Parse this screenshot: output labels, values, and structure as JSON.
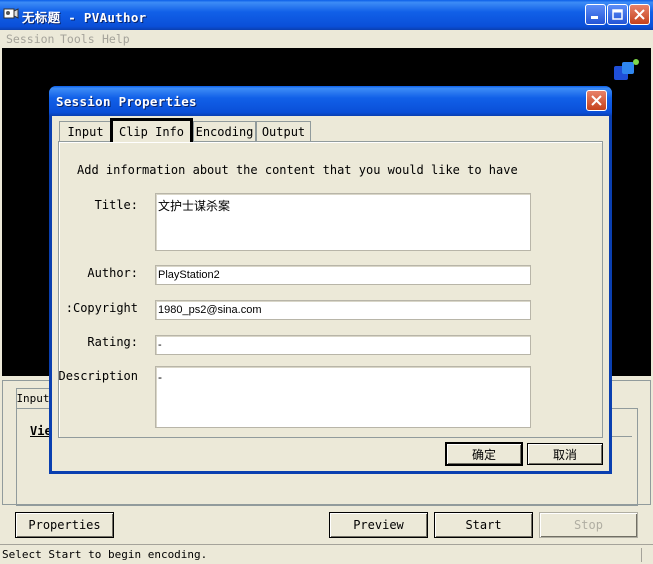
{
  "window": {
    "title": "无标题 - PVAuthor"
  },
  "menu": {
    "items": [
      "Session",
      "Tools",
      "Help"
    ]
  },
  "background_panel": {
    "tab_label": "Input",
    "group_label": "Vie"
  },
  "buttons": {
    "properties": "Properties",
    "preview": "Preview",
    "start": "Start",
    "stop": "Stop"
  },
  "status_bar": {
    "text": "Select Start to begin encoding."
  },
  "dialog": {
    "title": "Session Properties",
    "tabs": [
      "Input",
      "Clip Info",
      "Encoding",
      "Output"
    ],
    "active_tab": "Clip Info",
    "instruction": "Add information about the content that you would like to have",
    "fields": {
      "title": {
        "label": "Title:",
        "value": "文护士谋杀案"
      },
      "author": {
        "label": "Author:",
        "value": "PlayStation2"
      },
      "copyright": {
        "label": "Copyright:",
        "value": "1980_ps2@sina.com"
      },
      "rating": {
        "label": "Rating:",
        "value": "-"
      },
      "description": {
        "label": "Description:",
        "value": "-"
      }
    },
    "ok_label": "确定",
    "cancel_label": "取消"
  },
  "colors": {
    "title_bar": "#0a4fd8",
    "face": "#ece9d8",
    "video_area": "#000000"
  },
  "icons": [
    "app-icon",
    "minimize-icon",
    "maximize-icon",
    "close-icon",
    "logo-icon",
    "dialog-close-icon"
  ]
}
